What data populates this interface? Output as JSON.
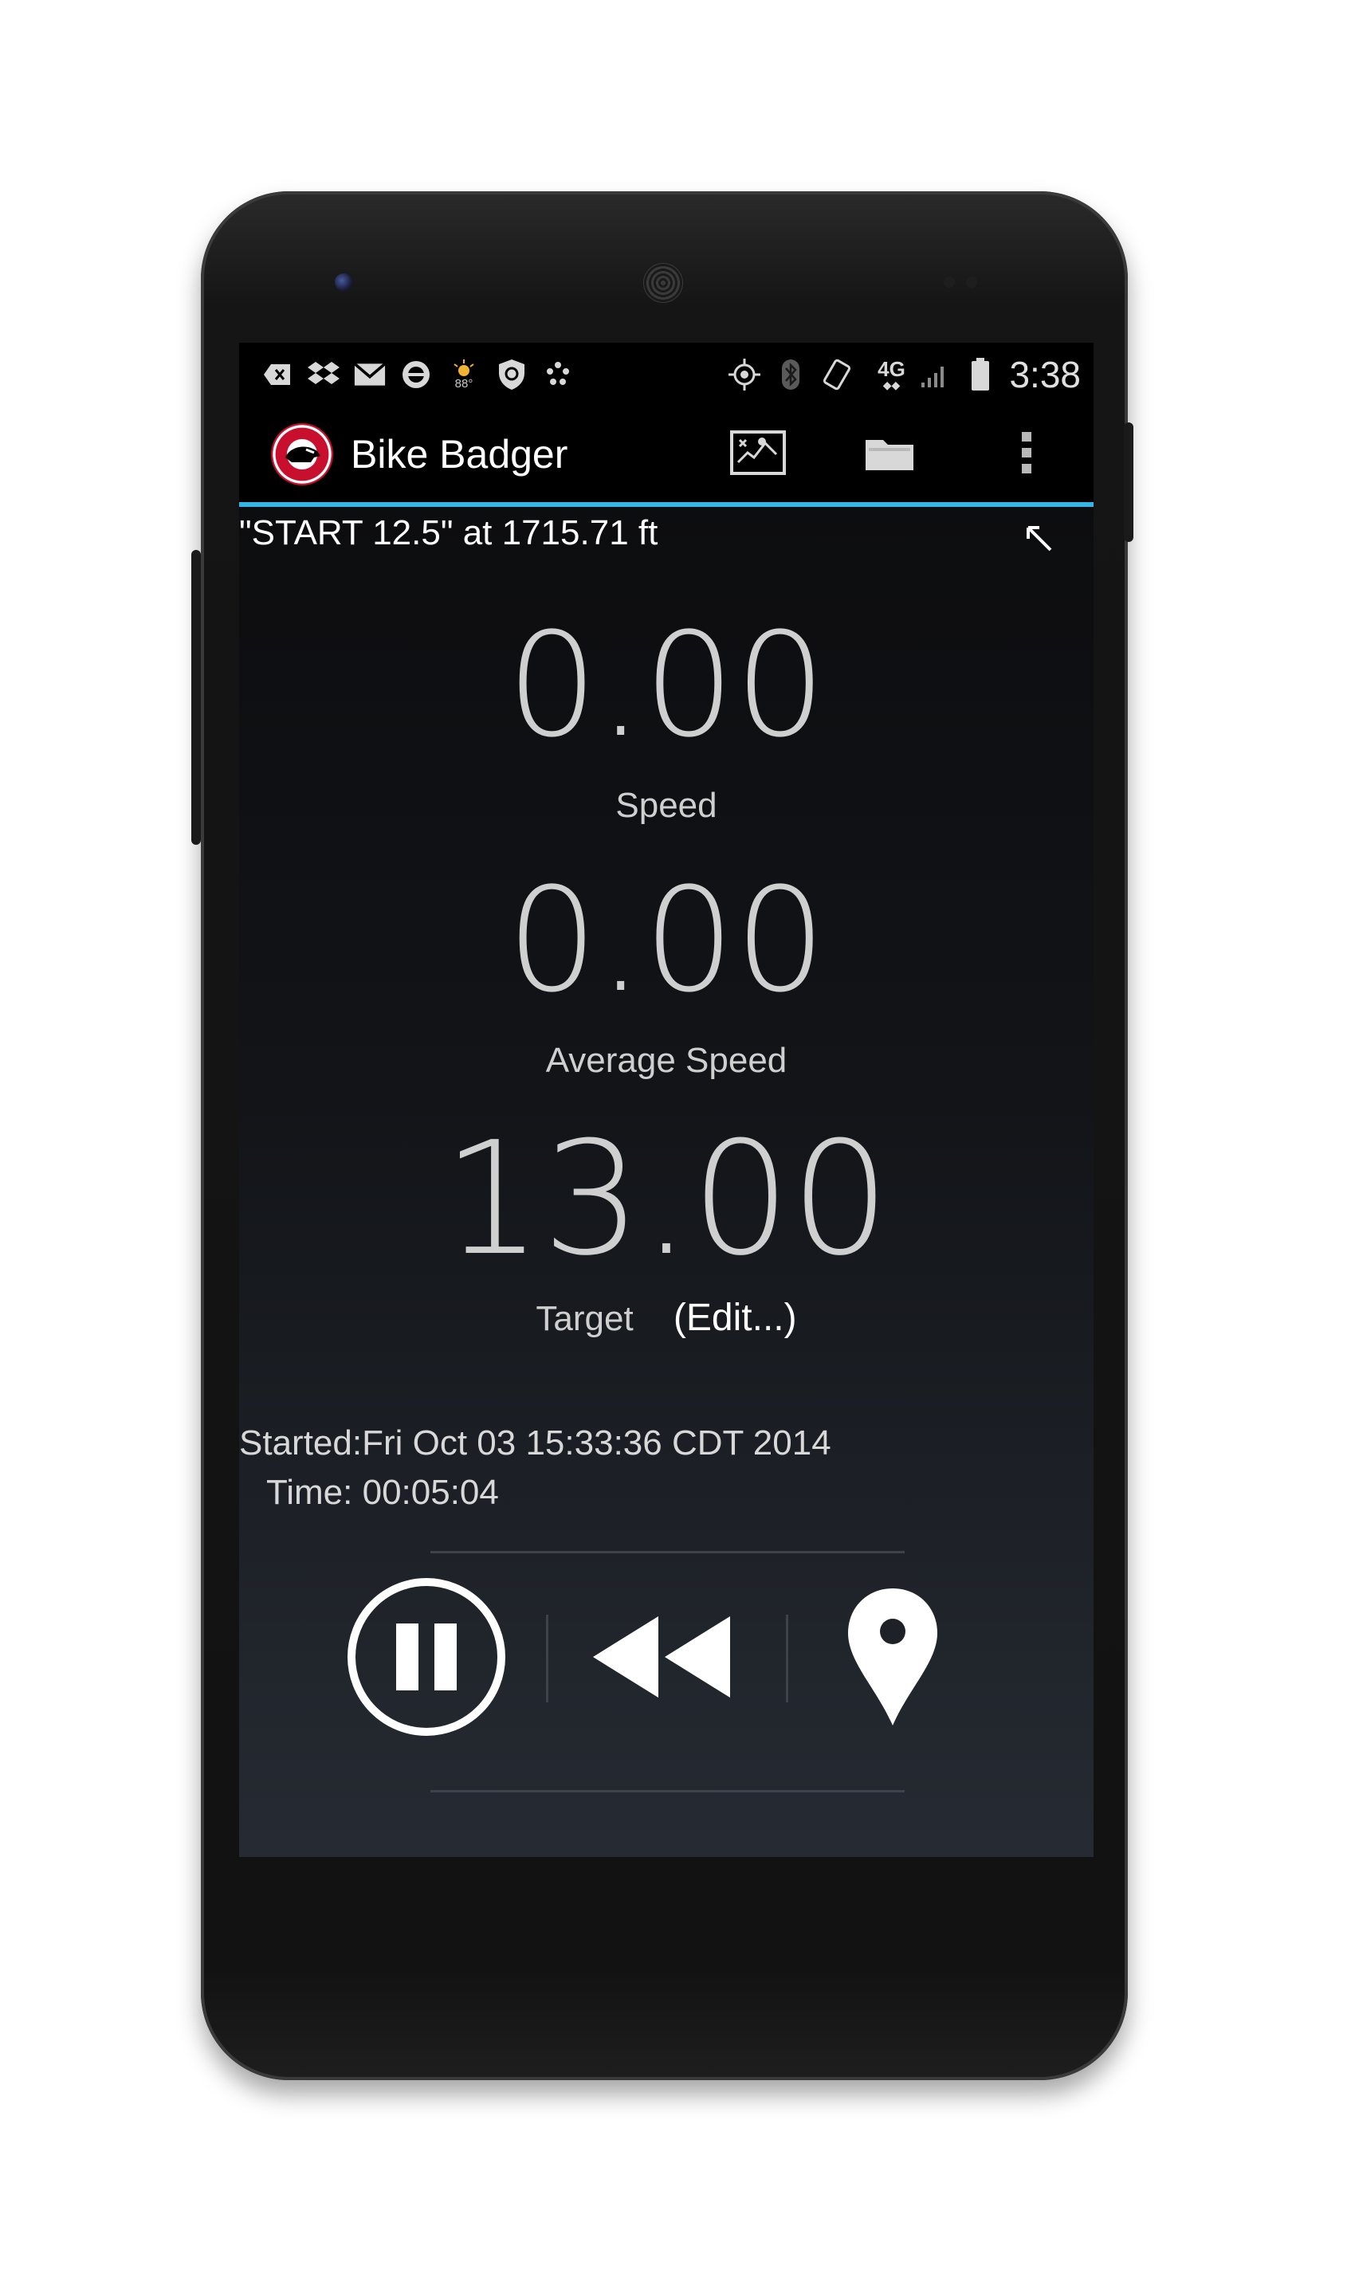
{
  "statusbar": {
    "left_icons": [
      "back-arrow-icon",
      "dropbox-icon",
      "gmail-icon",
      "bike-badger-icon",
      "weather-icon",
      "security-shield-icon",
      "dots-icon"
    ],
    "weather_temp": "88°",
    "right_icons": [
      "gps-icon",
      "bluetooth-icon",
      "rotation-lock-icon",
      "network-4g-lte-icon",
      "signal-icon",
      "battery-icon"
    ],
    "network_label": "4G",
    "time": "3:38"
  },
  "actionbar": {
    "title": "Bike Badger",
    "actions": [
      "map-icon",
      "folder-icon",
      "overflow-menu-icon"
    ],
    "accent": "#33b5e5"
  },
  "waypoint": {
    "text": "\"START 12.5\" at 1715.71 ft",
    "direction_icon": "arrow-up-left-icon"
  },
  "metrics": {
    "speed": {
      "value": "0.00",
      "label": "Speed"
    },
    "average_speed": {
      "value": "0.00",
      "label": "Average Speed"
    },
    "target": {
      "value": "13.00",
      "label": "Target",
      "edit_label": "(Edit...)"
    }
  },
  "session": {
    "started": "Started:Fri Oct 03 15:33:36 CDT 2014",
    "time": "Time: 00:05:04"
  },
  "controls": [
    "pause-icon",
    "rewind-icon",
    "location-pin-icon"
  ]
}
